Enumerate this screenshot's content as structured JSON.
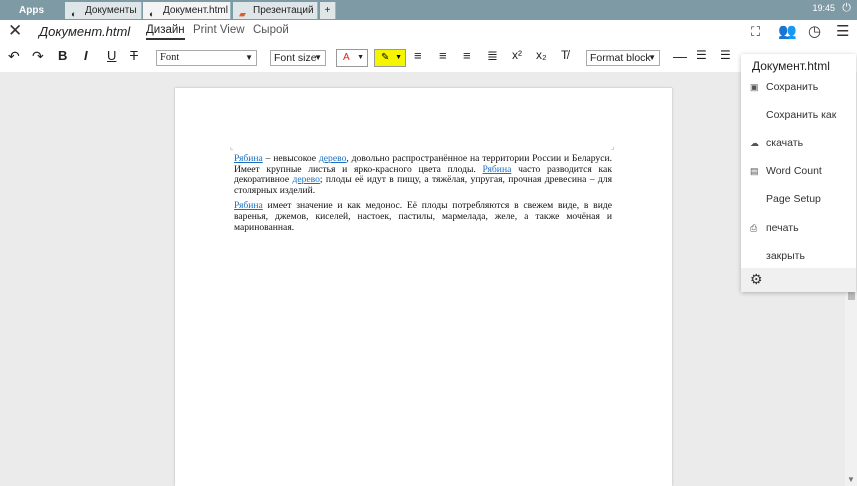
{
  "taskbar": {
    "apps": "Apps",
    "tabs": [
      {
        "label": "Документы",
        "icon": "docs-icon"
      },
      {
        "label": "Документ.html",
        "icon": "html-doc-icon"
      },
      {
        "label": "Презентаций",
        "icon": "presentation-icon"
      }
    ],
    "plus": "+",
    "time": "19:45"
  },
  "header": {
    "title": "Документ.html",
    "tabs": [
      "Дизайн",
      "Print View",
      "Сырой"
    ],
    "active_tab": "Дизайн"
  },
  "toolbar": {
    "font_value": "Font",
    "font_size_value": "Font size",
    "font_color_value": "A",
    "format_block_value": "Format block",
    "highlight_color": "#f5f500",
    "font_color": "#e02020"
  },
  "document": {
    "p1": [
      {
        "text": "Рябина",
        "link": true
      },
      {
        "text": " – невысокое ",
        "link": false
      },
      {
        "text": "дерево",
        "link": true
      },
      {
        "text": ", довольно распространённое на территории России и Беларуси. Имеет крупные листья и ярко-красного цвета плоды. ",
        "link": false
      },
      {
        "text": "Рябина",
        "link": true
      },
      {
        "text": " часто разводится как декоративное ",
        "link": false
      },
      {
        "text": "дерево",
        "link": true
      },
      {
        "text": "; плоды её идут в пищу, а тяжёлая, упругая, прочная древесина – для столярных изделий.",
        "link": false
      }
    ],
    "p2": [
      {
        "text": "Рябина",
        "link": true
      },
      {
        "text": " имеет значение и как медонос. Её плоды потребляются в свежем виде, в виде варенья, джемов, киселей, настоек, пастилы, мармелада, желе, а также мочёная и маринованная.",
        "link": false
      }
    ]
  },
  "menu": {
    "title": "Документ.html",
    "items": [
      {
        "label": "Сохранить",
        "icon": "save-icon"
      },
      {
        "label": "Сохранить как",
        "icon": ""
      },
      {
        "label": "скачать",
        "icon": "cloud-download-icon"
      },
      {
        "label": "Word Count",
        "icon": "word-count-icon"
      },
      {
        "label": "Page Setup",
        "icon": ""
      },
      {
        "label": "печать",
        "icon": "print-icon"
      },
      {
        "label": "закрыть",
        "icon": ""
      }
    ]
  }
}
